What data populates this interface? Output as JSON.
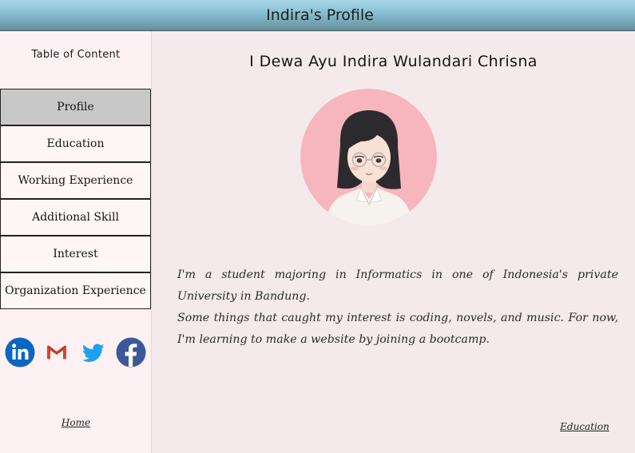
{
  "header": {
    "title": "Indira's Profile"
  },
  "sidebar": {
    "toc_title": "Table of Content",
    "items": [
      {
        "label": "Profile",
        "active": true
      },
      {
        "label": "Education",
        "active": false
      },
      {
        "label": "Working Experience",
        "active": false
      },
      {
        "label": "Additional Skill",
        "active": false
      },
      {
        "label": "Interest",
        "active": false
      },
      {
        "label": "Organization Experience",
        "active": false
      }
    ],
    "socials": [
      {
        "icon": "linkedin-icon",
        "color": "#0a66c2"
      },
      {
        "icon": "gmail-icon",
        "color": "#d44638"
      },
      {
        "icon": "twitter-icon",
        "color": "#1da1f2"
      },
      {
        "icon": "facebook-icon",
        "color": "#3b5998"
      }
    ],
    "home_link": "Home"
  },
  "main": {
    "name": "I Dewa Ayu Indira Wulandari Chrisna",
    "avatar": {
      "icon": "profile-avatar",
      "bg_color": "#f7b6bd"
    },
    "bio": [
      "I'm a student majoring in Informatics in one of Indonesia's private University in Bandung.",
      "Some things that caught my interest is coding, novels, and music. For now, I'm learning to make a website by joining a bootcamp."
    ],
    "next_link": "Education"
  }
}
